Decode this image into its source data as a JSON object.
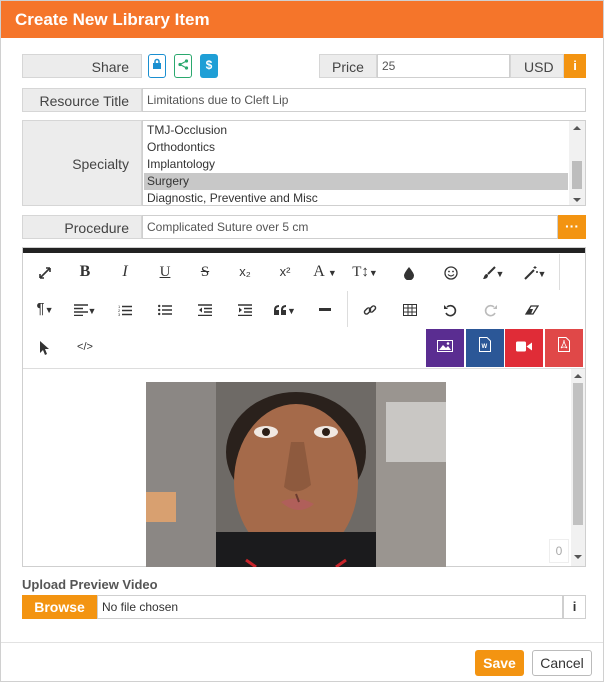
{
  "header": {
    "title": "Create New Library Item"
  },
  "share": {
    "label": "Share",
    "lock_icon": "lock-icon",
    "share_icon": "share-nodes-icon",
    "dollar_icon": "dollar-icon"
  },
  "price": {
    "label": "Price",
    "value": "25",
    "currency": "USD"
  },
  "resource_title": {
    "label": "Resource Title",
    "value": "Limitations due to Cleft Lip"
  },
  "specialty": {
    "label": "Specialty",
    "options": [
      "TMJ-Occlusion",
      "Orthodontics",
      "Implantology",
      "Surgery",
      "Diagnostic, Preventive and Misc"
    ],
    "selected": "Surgery"
  },
  "procedure": {
    "label": "Procedure",
    "value": "Complicated Suture over 5 cm",
    "more_label": "···"
  },
  "editor": {
    "toolbar_row1": [
      "expand-icon",
      "bold-icon",
      "italic-icon",
      "underline-icon",
      "strikethrough-icon",
      "subscript-icon",
      "superscript-icon",
      "font-color-icon",
      "font-size-icon",
      "color-drop-icon",
      "emoticon-icon",
      "paint-brush-icon",
      "magic-wand-icon"
    ],
    "toolbar_row2": [
      "paragraph-icon",
      "align-icon",
      "ordered-list-icon",
      "unordered-list-icon",
      "outdent-icon",
      "indent-icon",
      "quote-icon",
      "horizontal-rule-icon",
      "link-icon",
      "table-icon",
      "undo-icon",
      "redo-icon",
      "eraser-icon"
    ],
    "toolbar_row3": [
      "select-cursor-icon",
      "code-view-icon"
    ],
    "media_buttons": [
      {
        "icon": "insert-image-icon",
        "color": "#5a2d91"
      },
      {
        "icon": "insert-word-icon",
        "color": "#2b5797"
      },
      {
        "icon": "insert-video-icon",
        "color": "#e02c37"
      },
      {
        "icon": "insert-pdf-icon",
        "color": "#e04848"
      }
    ],
    "char_count": "0",
    "tb_labels": {
      "bold": "B",
      "italic": "I",
      "underline": "U",
      "strike": "S",
      "sub": "x₂",
      "sup": "x²",
      "fontcolor": "A",
      "fontsize": "T↕",
      "paragraph": "¶",
      "code": "</>"
    }
  },
  "upload": {
    "label": "Upload Preview Video",
    "browse": "Browse",
    "file_status": "No file chosen"
  },
  "actions": {
    "save": "Save",
    "cancel": "Cancel"
  },
  "colors": {
    "accent": "#f5752a",
    "orange_button": "#f39411",
    "share_lock": "#1a8fd0",
    "share_green": "#2aa86e",
    "share_dollar": "#1f9fd6"
  }
}
